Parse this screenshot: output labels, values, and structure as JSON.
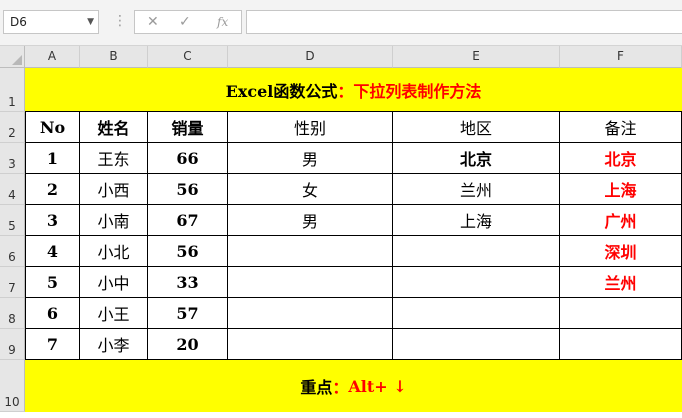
{
  "formula_bar": {
    "name_box": "D6",
    "cancel_icon": "✕",
    "enter_icon": "✓",
    "fx_icon": "fx",
    "formula": ""
  },
  "columns": [
    "A",
    "B",
    "C",
    "D",
    "E",
    "F"
  ],
  "rows": [
    "1",
    "2",
    "3",
    "4",
    "5",
    "6",
    "7",
    "8",
    "9",
    "10"
  ],
  "title": {
    "prefix": "Excel函数公式",
    "colon": "：",
    "suffix": "下拉列表制作方法"
  },
  "headers": [
    "No",
    "姓名",
    "销量",
    "性别",
    "地区",
    "备注"
  ],
  "data_rows": [
    [
      "1",
      "王东",
      "66",
      "男",
      "北京",
      "北京"
    ],
    [
      "2",
      "小西",
      "56",
      "女",
      "兰州",
      "上海"
    ],
    [
      "3",
      "小南",
      "67",
      "男",
      "上海",
      "广州"
    ],
    [
      "4",
      "小北",
      "56",
      "",
      "",
      "深圳"
    ],
    [
      "5",
      "小中",
      "33",
      "",
      "",
      "兰州"
    ],
    [
      "6",
      "小王",
      "57",
      "",
      "",
      ""
    ],
    [
      "7",
      "小李",
      "20",
      "",
      "",
      ""
    ]
  ],
  "footer": {
    "label": "重点",
    "colon": "：",
    "shortcut": "Alt+ ↓"
  },
  "colors": {
    "highlight": "#ffff00",
    "accent_red": "#ff0000",
    "selection": "#217346"
  }
}
